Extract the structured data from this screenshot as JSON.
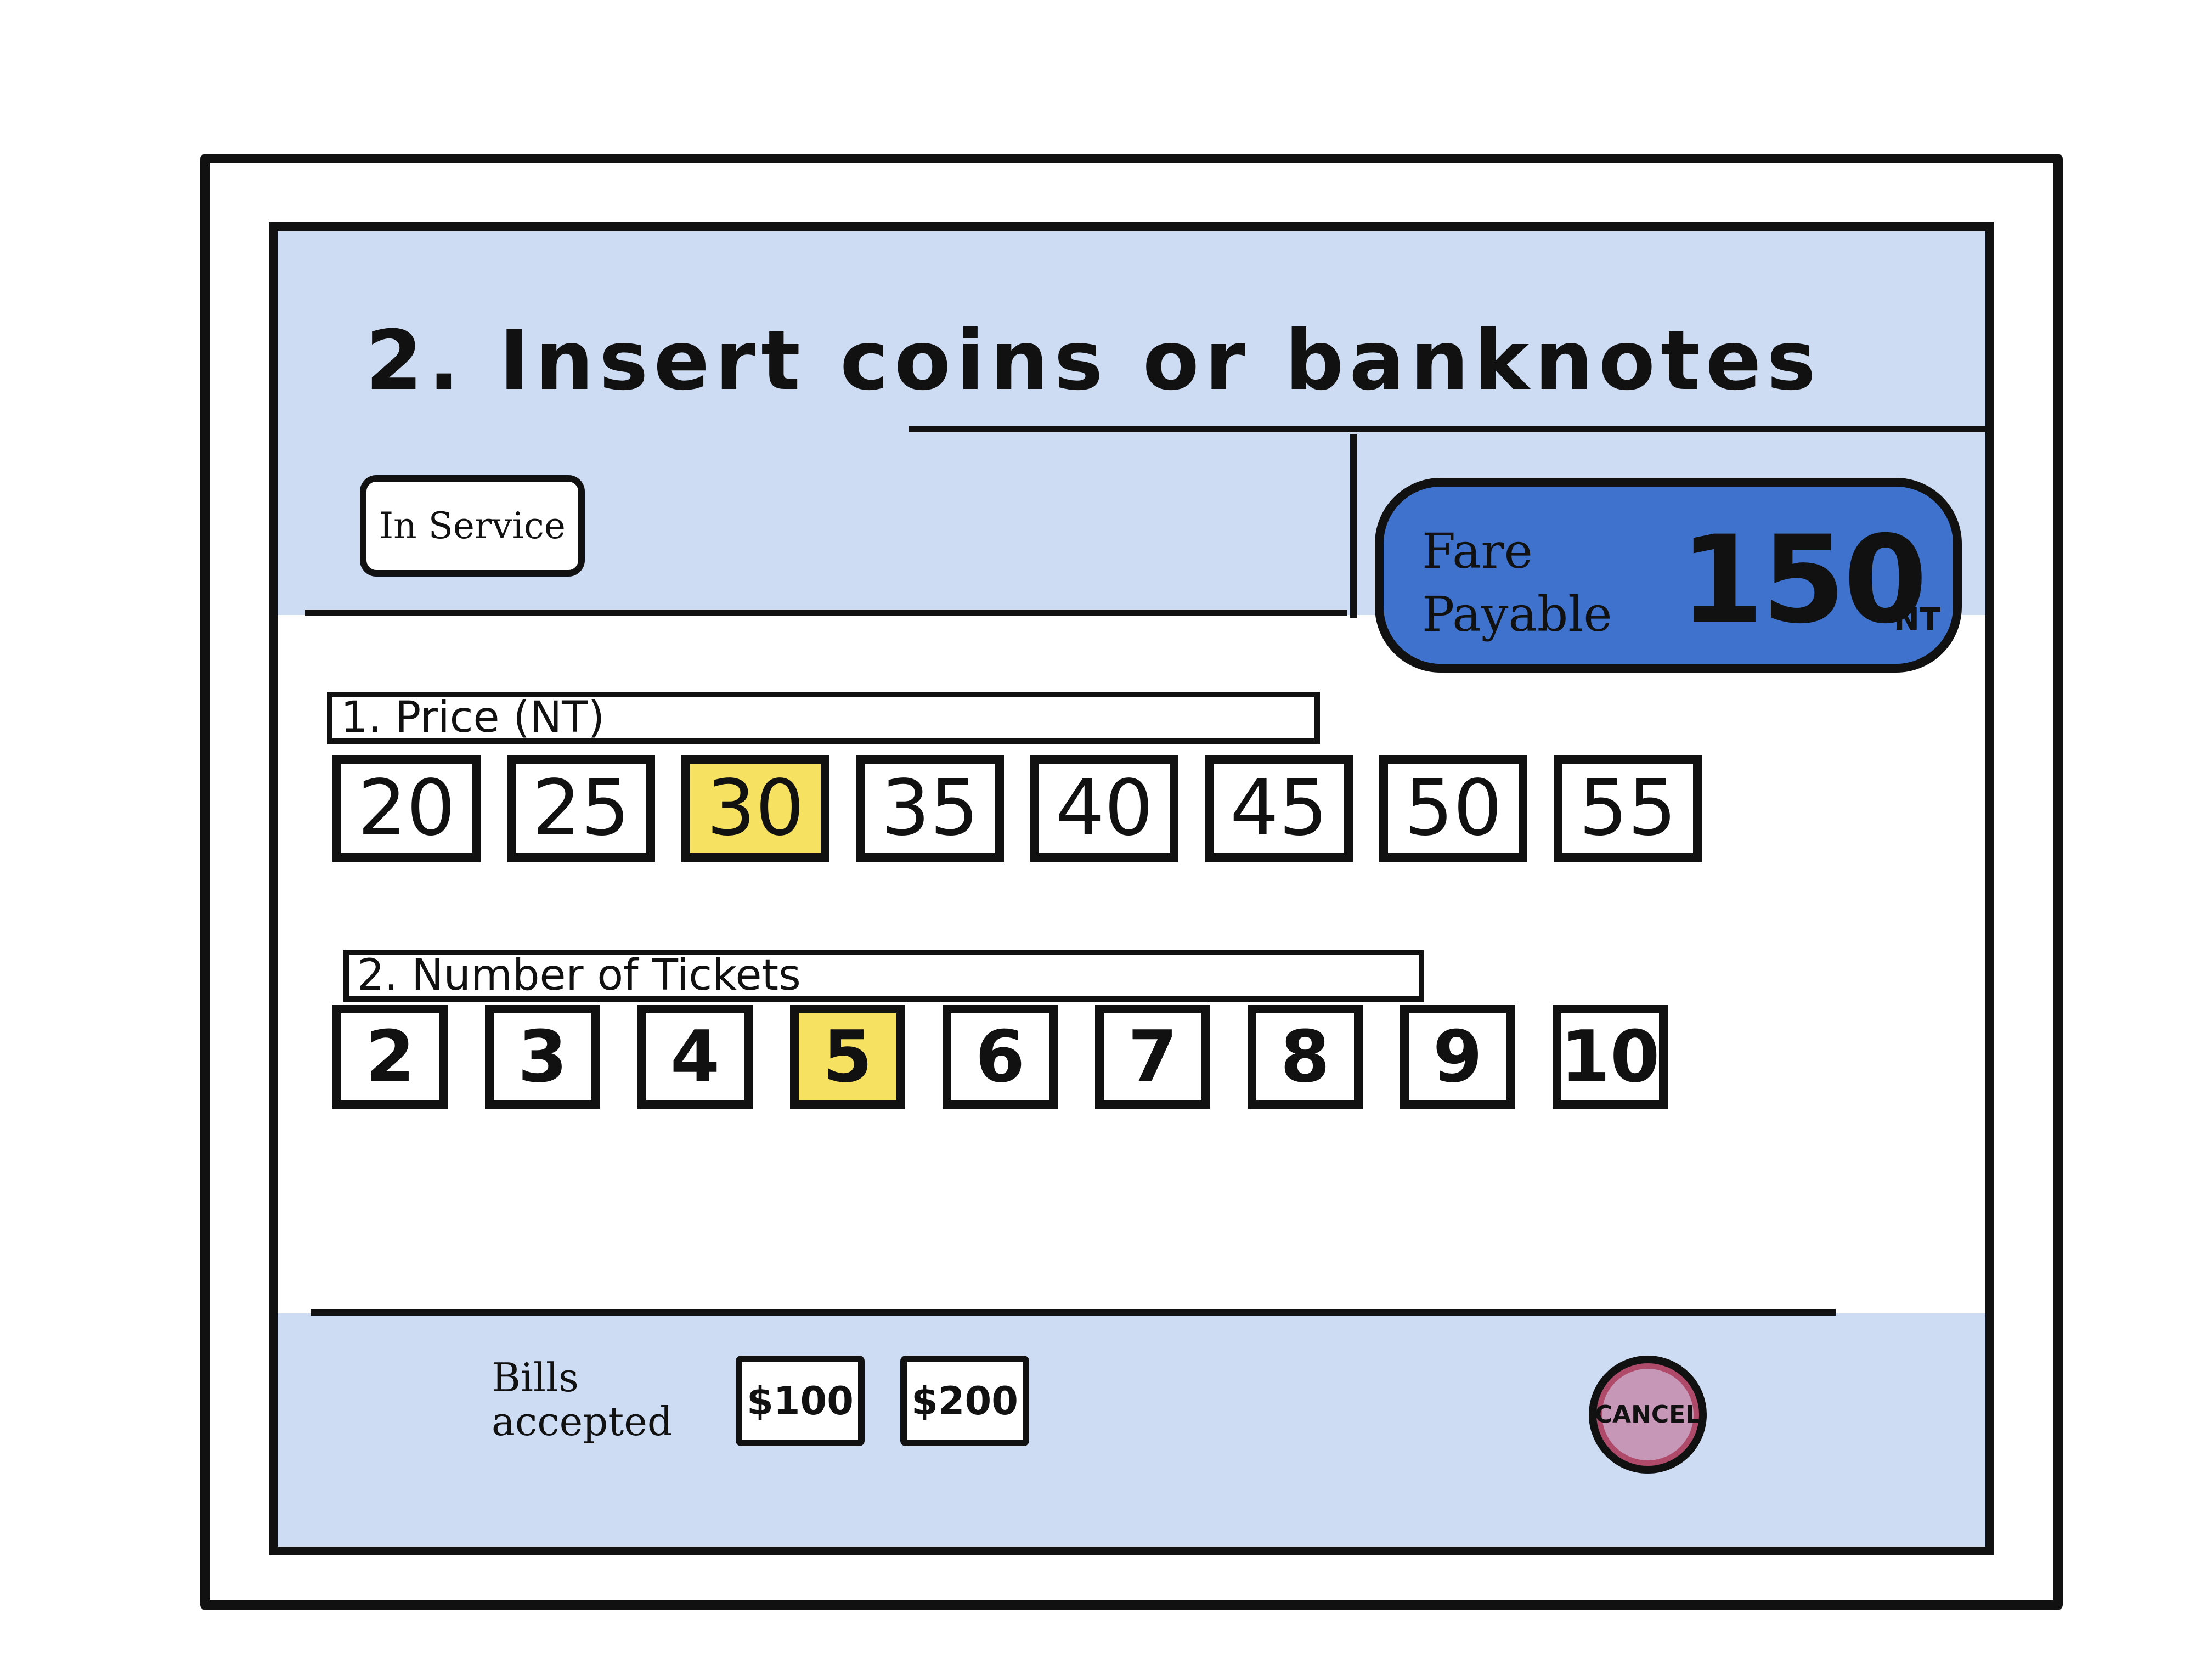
{
  "header": {
    "title": "2. Insert coins or banknotes"
  },
  "status": {
    "label": "In Service"
  },
  "fare": {
    "label_line1": "Fare",
    "label_line2": "Payable",
    "amount": "150",
    "currency": "NT"
  },
  "price_section": {
    "label": "1. Price (NT)",
    "options": [
      "20",
      "25",
      "30",
      "35",
      "40",
      "45",
      "50",
      "55"
    ],
    "selected": "30"
  },
  "tickets_section": {
    "label": "2. Number of Tickets",
    "options": [
      "2",
      "3",
      "4",
      "5",
      "6",
      "7",
      "8",
      "9",
      "10"
    ],
    "selected": "5"
  },
  "bills": {
    "label_line1": "Bills",
    "label_line2": "accepted",
    "notes": [
      "$100",
      "$200"
    ]
  },
  "cancel": {
    "label": "CANCEL"
  },
  "colors": {
    "screen_band": "#cddcf2",
    "fare_panel": "#3e72cc",
    "selected": "#f7e160",
    "cancel": "#c797b8"
  }
}
